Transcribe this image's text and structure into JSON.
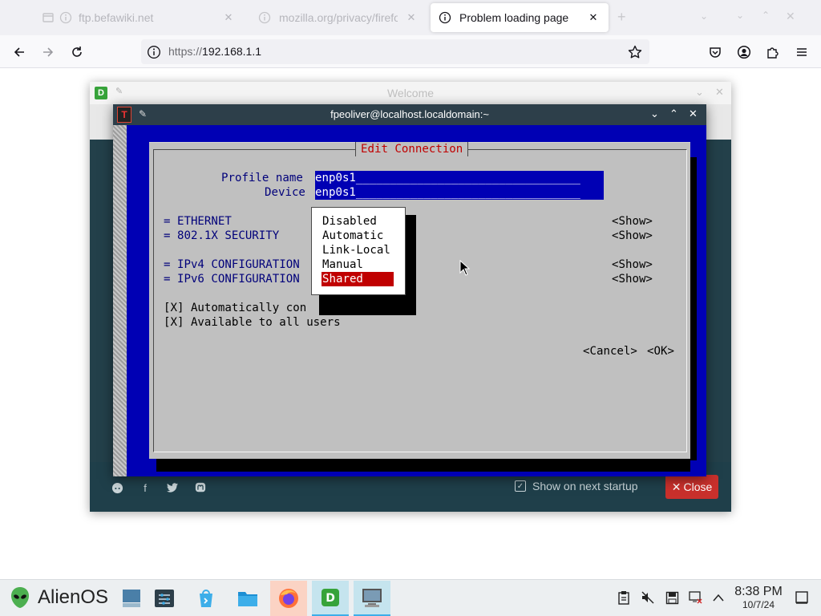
{
  "browser": {
    "tabs": [
      {
        "title": "ftp.befawiki.net",
        "state": "inactive",
        "icon": "tab-placeholder-icon"
      },
      {
        "title": "mozilla.org/privacy/firefox",
        "state": "inactive",
        "icon": "info-icon"
      },
      {
        "title": "Problem loading page",
        "state": "active",
        "icon": "info-icon"
      }
    ],
    "url": {
      "scheme": "https://",
      "host": "192.168.1.1"
    }
  },
  "welcome": {
    "title": "Welcome",
    "show_on_startup": "Show on next startup",
    "close_label": "Close"
  },
  "terminal": {
    "title": "fpeoliver@localhost.localdomain:~",
    "dialog": {
      "title": "Edit Connection",
      "profile_name_label": "Profile name",
      "profile_name_value": "enp0s1_________________________________",
      "device_label": "Device",
      "device_value": "enp0s1_________________________________",
      "sections": [
        {
          "label": "= ETHERNET",
          "action": "<Show>"
        },
        {
          "label": "= 802.1X SECURITY",
          "action": "<Show>"
        },
        {
          "label": "= IPv4 CONFIGURATION",
          "action": "<Show>"
        },
        {
          "label": "= IPv6 CONFIGURATION",
          "action": "<Show>"
        }
      ],
      "auto_connect": "[X] Automatically con",
      "all_users": "[X] Available to all users",
      "cancel": "<Cancel>",
      "ok": "<OK>",
      "menu": {
        "items": [
          "Disabled",
          "Automatic",
          "Link-Local",
          "Manual",
          "Shared"
        ],
        "selected": "Shared"
      }
    }
  },
  "taskbar": {
    "start_label": "AlienOS",
    "clock": {
      "time": "8:38 PM",
      "date": "10/7/24"
    }
  },
  "colors": {
    "terminal_blue": "#0000b4",
    "dialog_gray": "#c0c0c0",
    "selection_red": "#c00000",
    "welcome_dark": "#1f3f4a",
    "close_red": "#c9302c"
  }
}
